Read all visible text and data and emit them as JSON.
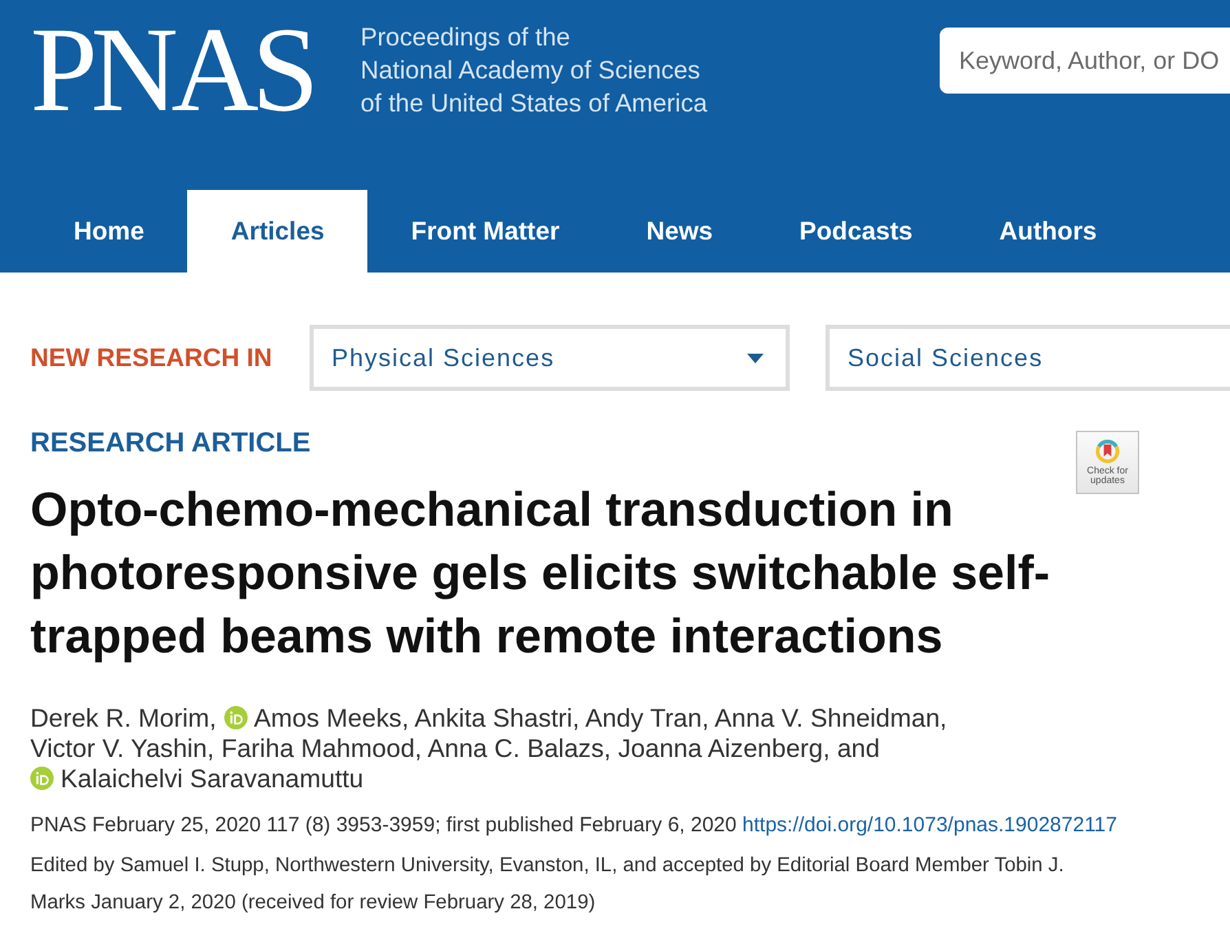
{
  "header": {
    "logo": "PNAS",
    "tagline": [
      "Proceedings of the",
      "National Academy of Sciences",
      "of the United States of America"
    ],
    "search": {
      "placeholder": "Keyword, Author, or DO"
    }
  },
  "nav": {
    "tabs": [
      {
        "label": "Home",
        "selected": false
      },
      {
        "label": "Articles",
        "selected": true
      },
      {
        "label": "Front Matter",
        "selected": false
      },
      {
        "label": "News",
        "selected": false
      },
      {
        "label": "Podcasts",
        "selected": false
      },
      {
        "label": "Authors",
        "selected": false
      }
    ]
  },
  "research_filter": {
    "label": "NEW RESEARCH IN",
    "dropdowns": [
      {
        "value": "Physical Sciences",
        "caret": true
      },
      {
        "value": "Social Sciences",
        "caret": false
      }
    ]
  },
  "article": {
    "type_label": "RESEARCH ARTICLE",
    "update_badge": {
      "label": "Check for updates"
    },
    "title": "Opto-chemo-mechanical transduction in photoresponsive gels elicits switchable self-trapped beams with remote interactions",
    "byline": [
      {
        "kind": "author",
        "name": "Derek R. Morim,",
        "orcid": false
      },
      {
        "kind": "author",
        "name": "Amos Meeks,",
        "orcid": true
      },
      {
        "kind": "author",
        "name": "Ankita Shastri,",
        "orcid": false
      },
      {
        "kind": "author",
        "name": "Andy Tran,",
        "orcid": false
      },
      {
        "kind": "author",
        "name": "Anna V. Shneidman,",
        "orcid": false
      },
      {
        "kind": "author",
        "name": "Victor V. Yashin,",
        "orcid": false
      },
      {
        "kind": "author",
        "name": "Fariha Mahmood,",
        "orcid": false
      },
      {
        "kind": "author",
        "name": "Anna C. Balazs,",
        "orcid": false
      },
      {
        "kind": "author",
        "name": "Joanna Aizenberg,",
        "orcid": false
      },
      {
        "kind": "conjunction",
        "text": "and"
      },
      {
        "kind": "author",
        "name": "Kalaichelvi Saravanamuttu",
        "orcid": true
      }
    ],
    "citation": {
      "text": "PNAS February 25, 2020 117 (8) 3953-3959; first published February 6, 2020",
      "doi": "https://doi.org/10.1073/pnas.1902872117"
    },
    "edited_note": "Edited by Samuel I. Stupp, Northwestern University, Evanston, IL, and accepted by Editorial Board Member Tobin J. Marks January 2, 2020 (received for review February 28, 2019)"
  }
}
